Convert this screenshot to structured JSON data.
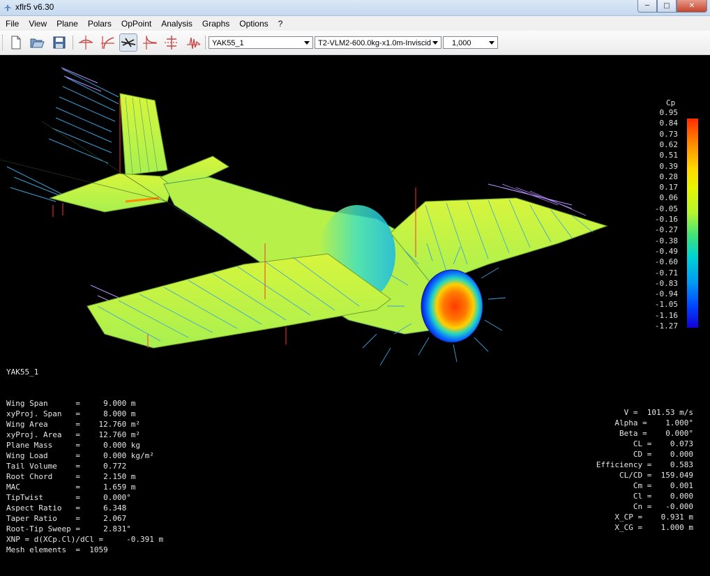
{
  "window": {
    "title": "xflr5 v6.30"
  },
  "menu": [
    "File",
    "View",
    "Plane",
    "Polars",
    "OpPoint",
    "Analysis",
    "Graphs",
    "Options",
    "?"
  ],
  "toolbar": {
    "icons": [
      "new-file-icon",
      "open-folder-icon",
      "save-icon",
      "airfoil-view-icon",
      "polar-view-icon",
      "plane-view-icon",
      "cp-view-icon",
      "opp-view-icon",
      "graph-view-icon"
    ],
    "plane_select": "YAK55_1",
    "polar_select": "T2-VLM2-600.0kg-x1.0m-Inviscid",
    "opp_select": "1,000"
  },
  "legend": {
    "title": "Cp",
    "ticks": [
      "0.95",
      "0.84",
      "0.73",
      "0.62",
      "0.51",
      "0.39",
      "0.28",
      "0.17",
      "0.06",
      "-0.05",
      "-0.16",
      "-0.27",
      "-0.38",
      "-0.49",
      "-0.60",
      "-0.71",
      "-0.83",
      "-0.94",
      "-1.05",
      "-1.16",
      "-1.27"
    ]
  },
  "plane_info": {
    "name": "YAK55_1",
    "rows": [
      "Wing Span      =     9.000 m",
      "xyProj. Span   =     8.000 m",
      "Wing Area      =    12.760 m²",
      "xyProj. Area   =    12.760 m²",
      "Plane Mass     =     0.000 kg",
      "Wing Load      =     0.000 kg/m²",
      "Tail Volume    =     0.772",
      "Root Chord     =     2.150 m",
      "MAC            =     1.659 m",
      "TipTwist       =     0.000°",
      "Aspect Ratio   =     6.348",
      "Taper Ratio    =     2.067",
      "Root-Tip Sweep =     2.831°",
      "XNP = d(XCp.Cl)/dCl =     -0.391 m",
      "Mesh elements  =  1059"
    ]
  },
  "opp_info": {
    "rows": [
      "V =  101.53 m/s",
      "Alpha =    1.000°",
      "Beta =    0.000°",
      "CL =    0.073",
      "CD =    0.000",
      "Efficiency =    0.583",
      "CL/CD =  159.049",
      "Cm =    0.001",
      "Cl =    0.000",
      "Cn =   -0.000",
      "X_CP =    0.931 m",
      "X_CG =    1.000 m"
    ]
  }
}
